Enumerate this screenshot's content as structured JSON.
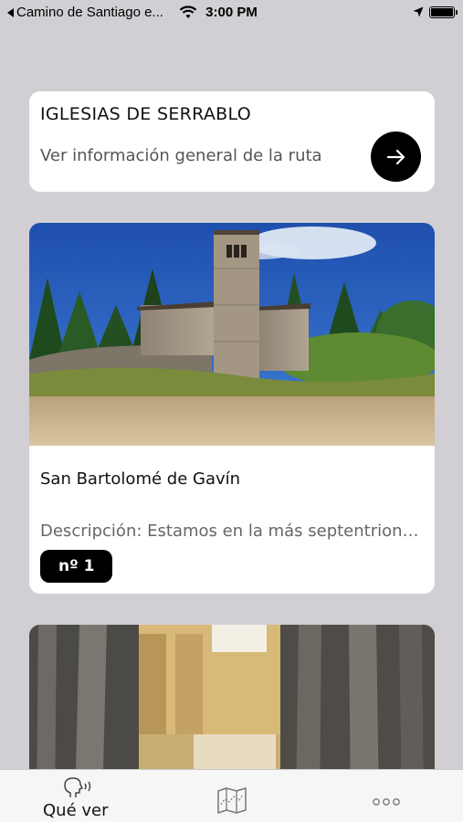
{
  "status_bar": {
    "back_app": "Camino de Santiago e...",
    "time": "3:00 PM"
  },
  "route_card": {
    "title": "IGLESIAS DE SERRABLO",
    "subtitle": "Ver información general de la ruta",
    "action_icon": "arrow-right-icon"
  },
  "church_card": {
    "name": "San Bartolomé de Gavín",
    "description": "Descripción: Estamos en la más septentrional de las iglesias del Serrablo",
    "badge": "nº 1"
  },
  "tabbar": {
    "tabs": [
      {
        "label": "Qué ver",
        "icon": "speaking-head-icon",
        "active": true
      },
      {
        "label": "",
        "icon": "map-icon",
        "active": false
      },
      {
        "label": "",
        "icon": "more-icon",
        "active": false
      }
    ]
  },
  "colors": {
    "background": "#d1cfd3",
    "card": "#ffffff",
    "accent": "#000000",
    "tabbar": "#f6f6f7"
  }
}
